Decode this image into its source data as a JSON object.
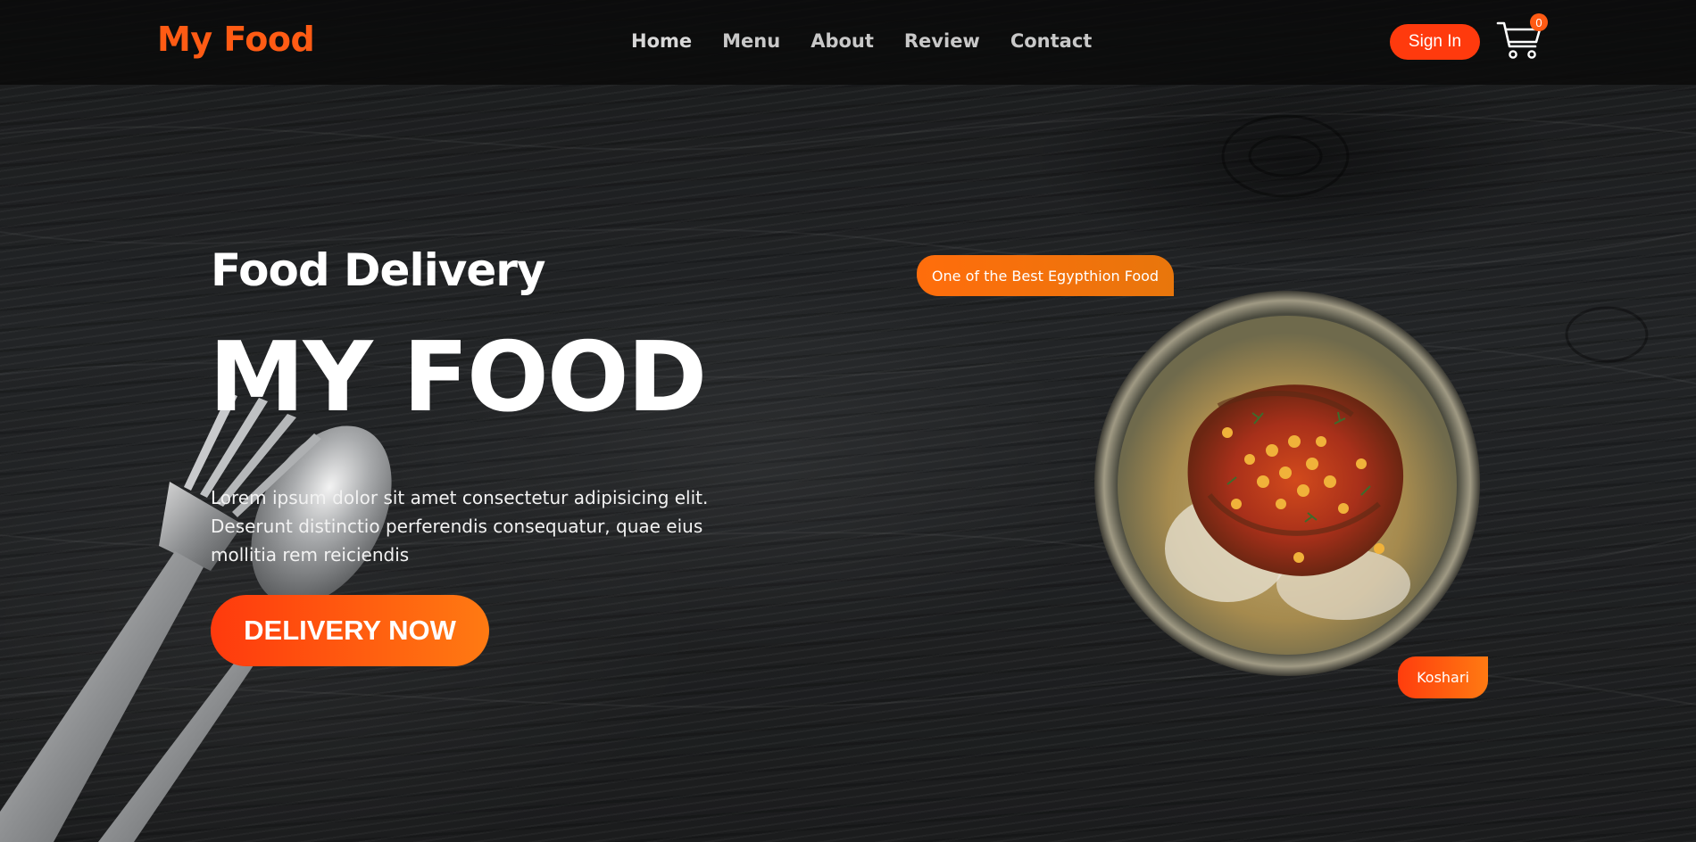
{
  "header": {
    "logo": "My Food",
    "nav": [
      "Home",
      "Menu",
      "About",
      "Review",
      "Contact"
    ],
    "signin_label": "Sign In",
    "cart_count": "0"
  },
  "hero": {
    "subtitle": "Food Delivery",
    "title": "MY FOOD",
    "description": "Lorem ipsum dolor sit amet consectetur adipisicing elit. Deserunt distinctio perferendis consequatur, quae eius mollitia rem reiciendis",
    "cta_label": "DELIVERY NOW"
  },
  "dish": {
    "tag": "One of the Best Egypthion Food",
    "name": "Koshari"
  },
  "icons": {
    "cart": "shopping-cart-icon",
    "fork": "fork-icon",
    "spoon": "spoon-icon"
  },
  "colors": {
    "accent": "#ff5b14",
    "button": "#ff3a0d",
    "nav_text": "#c8c8c8",
    "background": "#1a1b1c"
  }
}
